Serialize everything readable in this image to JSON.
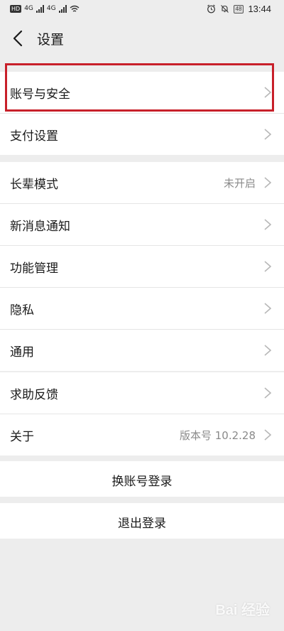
{
  "status_bar": {
    "hd_badge": "HD",
    "signal_1": "4G",
    "signal_2": "4G",
    "battery": "48",
    "time": "13:44"
  },
  "nav": {
    "title": "设置"
  },
  "groups": [
    {
      "rows": [
        {
          "label": "账号与安全",
          "value": ""
        },
        {
          "label": "支付设置",
          "value": ""
        }
      ]
    },
    {
      "rows": [
        {
          "label": "长辈模式",
          "value": "未开启"
        },
        {
          "label": "新消息通知",
          "value": ""
        },
        {
          "label": "功能管理",
          "value": ""
        },
        {
          "label": "隐私",
          "value": ""
        },
        {
          "label": "通用",
          "value": ""
        }
      ]
    },
    {
      "rows": [
        {
          "label": "求助反馈",
          "value": ""
        },
        {
          "label": "关于",
          "value": "版本号 10.2.28"
        }
      ]
    }
  ],
  "actions": {
    "switch_account": "换账号登录",
    "logout": "退出登录"
  },
  "watermark": "Bai 经验",
  "colors": {
    "background": "#ededed",
    "highlight": "#c8202a"
  }
}
